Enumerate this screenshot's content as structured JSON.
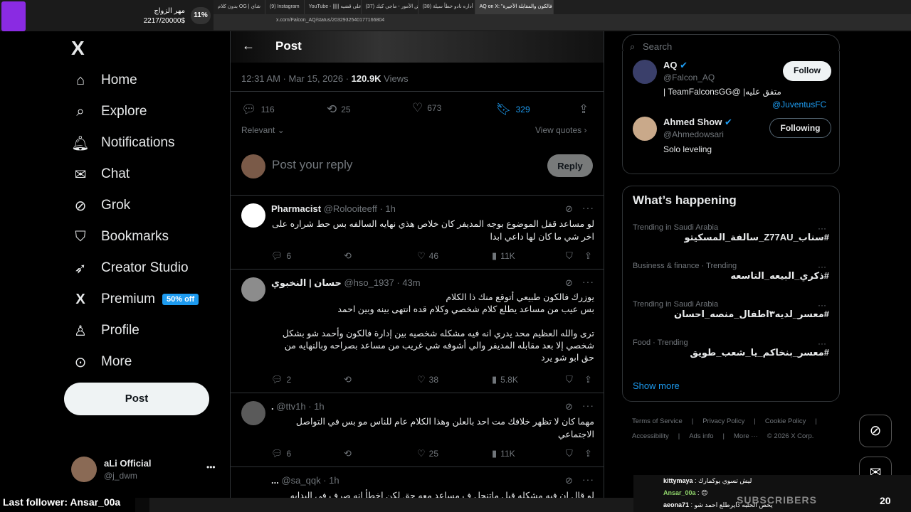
{
  "browser": {
    "tabs": [
      "بدون كلام OG | شاي",
      "(9) Instagram",
      "YouTube - ||||| رفع على قضيه",
      "(37) توضيح بعض الأمور - ماجي كيك",
      "(38) هل أداره نادو خطأ سيلة",
      "AQ on X: \"إدارة فالكون والمقابلة الأخيرة"
    ],
    "url": "x.com/Falcon_AQ/status/2032932540177166804"
  },
  "donation": {
    "title": "مهر الزواج",
    "amount": "2217/20000$",
    "percent": "11%",
    "percent_value": 0.11
  },
  "nav": {
    "logo": "X",
    "items": [
      {
        "label": "Home",
        "icon": "home-icon",
        "glyph": "⌂"
      },
      {
        "label": "Explore",
        "icon": "search-icon",
        "glyph": "⌕"
      },
      {
        "label": "Notifications",
        "icon": "bell-icon",
        "glyph": "🔔︎"
      },
      {
        "label": "Chat",
        "icon": "mail-icon",
        "glyph": "✉"
      },
      {
        "label": "Grok",
        "icon": "grok-icon",
        "glyph": "⊘"
      },
      {
        "label": "Bookmarks",
        "icon": "bookmark-icon",
        "glyph": "⛉"
      },
      {
        "label": "Creator Studio",
        "icon": "rocket-icon",
        "glyph": "➶"
      },
      {
        "label": "Premium",
        "icon": "x-logo-icon",
        "glyph": "X"
      },
      {
        "label": "Profile",
        "icon": "person-icon",
        "glyph": "♙"
      },
      {
        "label": "More",
        "icon": "more-circle-icon",
        "glyph": "⊙"
      }
    ],
    "premium_badge": "50% off",
    "post_button": "Post",
    "account": {
      "name": "aLi Official",
      "handle": "@j_dwm",
      "more": "•••"
    }
  },
  "post": {
    "header_title": "Post",
    "time": "12:31 AM · Mar 15, 2026 · ",
    "views_count": "120.9K",
    "views_label": " Views",
    "replies": "116",
    "reposts": "25",
    "likes": "673",
    "bookmarks": "329",
    "relevant": "Relevant",
    "view_quotes": "View quotes",
    "reply_placeholder": "Post your reply",
    "reply_button": "Reply"
  },
  "replies": [
    {
      "name": "Pharmacist",
      "handle": "@Rolooiteeff · 1h",
      "text": "لو مساعد قفل الموضوع بوجه المديفر كان خلاص هذي نهايه السالفه بس حط شراره على اخر شي ما كان لها داعي ابدا",
      "replies": "6",
      "reposts": "",
      "likes": "46",
      "views": "11K"
    },
    {
      "name": "حسان | النخبوي",
      "handle": "@hso_1937 · 43m",
      "text": "يوزرك فالكون طبيعي أتوقع منك ذا الكلام\nبس عيب من مساعد يطلع كلام شخصي وكلام قده انتهى بينه وبين احمد\n\nترى والله العظيم محد يدري انه فيه مشكله شخصيه بين إدارة فالكون وأحمد شو بشكل شخصي إلا بعد مقابله المديفر والي أشوفه شي غريب من مساعد بصراحه وبالنهايه من حق ابو شو يرد",
      "replies": "2",
      "reposts": "",
      "likes": "38",
      "views": "5.8K"
    },
    {
      "name": ".",
      "handle": "@ttv1h · 1h",
      "text": "مهما كان لا تظهر خلافك مت احد بالعلن وهذا الكلام عام للناس مو بس في التواصل الاجتماعي",
      "replies": "6",
      "reposts": "",
      "likes": "25",
      "views": "11K"
    },
    {
      "name": "...",
      "handle": "@sa_qqk · 1h",
      "text": "لو قال ان فيه مشكله قبل ماتنحل ف مساعد معه حق لكن اخطأ انه صرف في البدايه",
      "replies": "",
      "reposts": "",
      "likes": "",
      "views": ""
    }
  ],
  "right": {
    "search_placeholder": "Search",
    "people": [
      {
        "name": "AQ",
        "handle": "@Falcon_AQ",
        "button": "Follow",
        "bio1": "متفق عليه| @TeamFalconsGG |",
        "bio2": "@JuventusFC"
      },
      {
        "name": "Ahmed Show",
        "handle": "@Ahmedowsari",
        "button": "Following",
        "bio1": "Solo leveling"
      }
    ],
    "happening_title": "What’s happening",
    "trends": [
      {
        "context": "Trending in Saudi Arabia",
        "title": "#سناب_Z77AU_سالفة_المسكيتو"
      },
      {
        "context": "Business & finance · Trending",
        "title": "#ذكري_البيعه_التاسعه"
      },
      {
        "context": "Trending in Saudi Arabia",
        "title": "#معسر_لديه٣اطفال_منصه_احسان"
      },
      {
        "context": "Food · Trending",
        "title": "#معسر_بنخاكم_يا_شعب_طويق"
      }
    ],
    "show_more": "Show more",
    "footer": [
      "Terms of Service",
      "|",
      "Privacy Policy",
      "|",
      "Cookie Policy",
      "|",
      "Accessibility",
      "|",
      "Ads info",
      "|",
      "More ···",
      "© 2026 X Corp."
    ]
  },
  "stream": {
    "last_follower": "Last follower: Ansar_00a",
    "chat": [
      {
        "user": "kittymaya",
        "msg": "ليش تسوي يوكمارك"
      },
      {
        "user": "Ansar_00a",
        "msg": "😊"
      },
      {
        "user": "aeona71",
        "msg": "يخص الحلبه دايرطلع احمد شو"
      }
    ],
    "subscribers_label": "SUBSCRIBERS",
    "subscribers_count": "20"
  },
  "colors": {
    "accent": "#1d9bf0",
    "background": "#000000",
    "border": "#2f3336",
    "muted": "#71767b"
  }
}
